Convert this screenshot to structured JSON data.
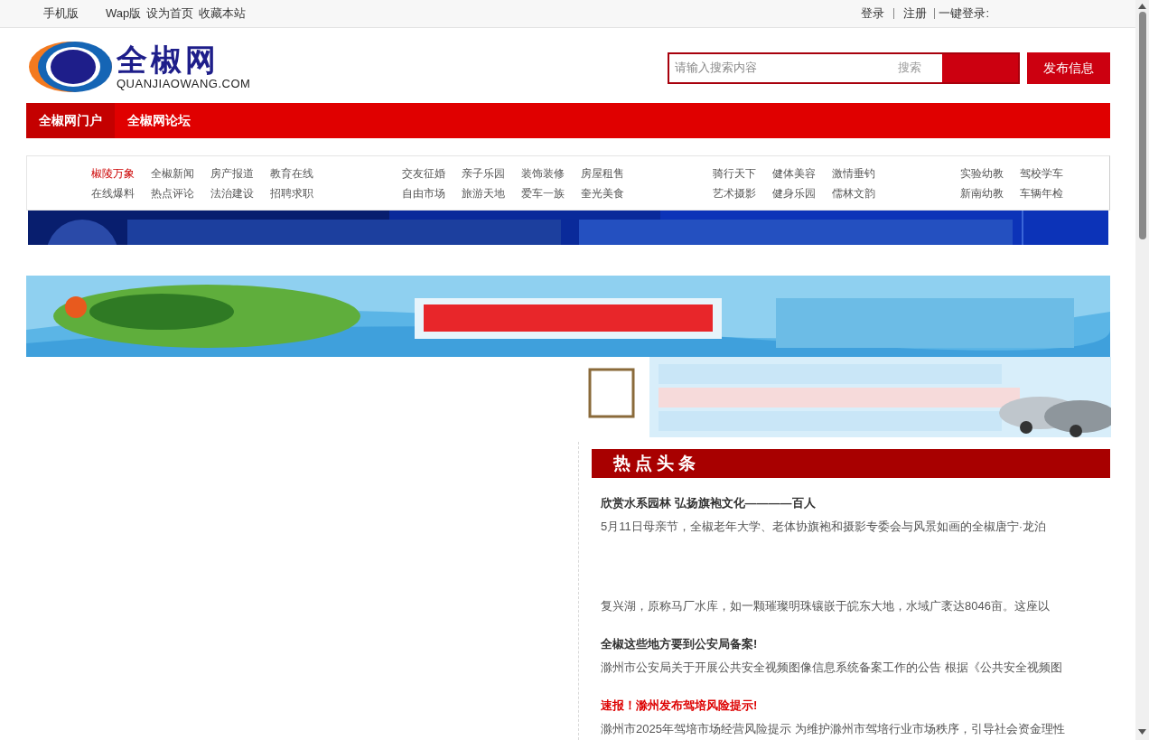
{
  "top_bar": {
    "left_links": [
      "手机版",
      "Wap版",
      "设为首页",
      "收藏本站"
    ],
    "right_links": [
      "登录",
      "注册"
    ],
    "quick_login": "一键登录:"
  },
  "logo": {
    "name": "全椒网",
    "domain": "QUANJIAOWANG.COM"
  },
  "search": {
    "placeholder": "请输入搜索内容",
    "button": "搜索"
  },
  "publish_button": "发布信息",
  "nav": [
    {
      "label": "全椒网门户",
      "selected": true
    },
    {
      "label": "全椒网论坛",
      "selected": false
    }
  ],
  "category_groups": [
    {
      "items": [
        {
          "label": "椒陵万象",
          "highlight": true
        },
        {
          "label": "全椒新闻",
          "highlight": false
        },
        {
          "label": "房产报道",
          "highlight": false
        },
        {
          "label": "教育在线",
          "highlight": false
        },
        {
          "label": "在线爆料",
          "highlight": false
        },
        {
          "label": "热点评论",
          "highlight": false
        },
        {
          "label": "法治建设",
          "highlight": false
        },
        {
          "label": "招聘求职",
          "highlight": false
        }
      ]
    },
    {
      "items": [
        {
          "label": "交友征婚",
          "highlight": false
        },
        {
          "label": "亲子乐园",
          "highlight": false
        },
        {
          "label": "装饰装修",
          "highlight": false
        },
        {
          "label": "房屋租售",
          "highlight": false
        },
        {
          "label": "自由市场",
          "highlight": false
        },
        {
          "label": "旅游天地",
          "highlight": false
        },
        {
          "label": "爱车一族",
          "highlight": false
        },
        {
          "label": "奎光美食",
          "highlight": false
        }
      ]
    },
    {
      "items": [
        {
          "label": "骑行天下",
          "highlight": false
        },
        {
          "label": "健体美容",
          "highlight": false
        },
        {
          "label": "激情垂钓",
          "highlight": false
        },
        {
          "label": "艺术摄影",
          "highlight": false
        },
        {
          "label": "健身乐园",
          "highlight": false
        },
        {
          "label": "儒林文韵",
          "highlight": false
        }
      ]
    },
    {
      "items": [
        {
          "label": "实验幼教",
          "highlight": false
        },
        {
          "label": "驾校学车",
          "highlight": false
        },
        {
          "label": "新南幼教",
          "highlight": false
        },
        {
          "label": "车辆年检",
          "highlight": false
        }
      ]
    }
  ],
  "hot_news": {
    "heading": "热点头条",
    "items": [
      {
        "title": "欣赏水系园林 弘扬旗袍文化————百人",
        "summary": "5月11日母亲节，全椒老年大学、老体协旗袍和摄影专委会与风景如画的全椒唐宁·龙泊",
        "highlight": false
      },
      {
        "summary": "复兴湖，原称马厂水库，如一颗璀璨明珠镶嵌于皖东大地，水域广袤达8046亩。这座以"
      },
      {
        "title": "全椒这些地方要到公安局备案!",
        "summary": "滁州市公安局关于开展公共安全视频图像信息系统备案工作的公告 根据《公共安全视频图",
        "highlight": false
      },
      {
        "title": "速报！滁州发布驾培风险提示!",
        "summary": "滁州市2025年驾培市场经营风险提示 为维护滁州市驾培行业市场秩序，引导社会资金理性",
        "highlight": true
      }
    ]
  }
}
